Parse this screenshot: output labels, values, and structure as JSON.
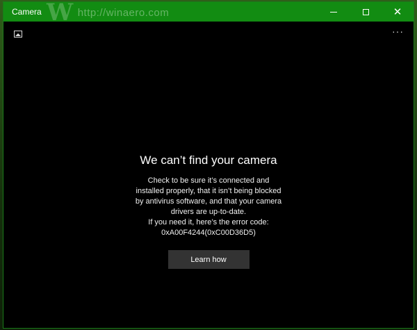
{
  "window": {
    "title": "Camera"
  },
  "watermark": {
    "text": "http://winaero.com",
    "letter": "W"
  },
  "titlebar_buttons": {
    "minimize": "minimize",
    "maximize": "maximize",
    "close": "✕"
  },
  "toolbar": {
    "more_label": "···"
  },
  "error": {
    "heading": "We can’t find your camera",
    "lines": [
      "Check to be sure it’s connected and",
      "installed properly, that it isn’t being blocked",
      "by antivirus software, and that your camera",
      "drivers are up-to-date.",
      "If you need it, here’s the error code:",
      "0xA00F4244(0xC00D36D5)"
    ],
    "button": "Learn how"
  },
  "colors": {
    "titlebar": "#128c12",
    "background": "#000000",
    "button": "#333333"
  }
}
